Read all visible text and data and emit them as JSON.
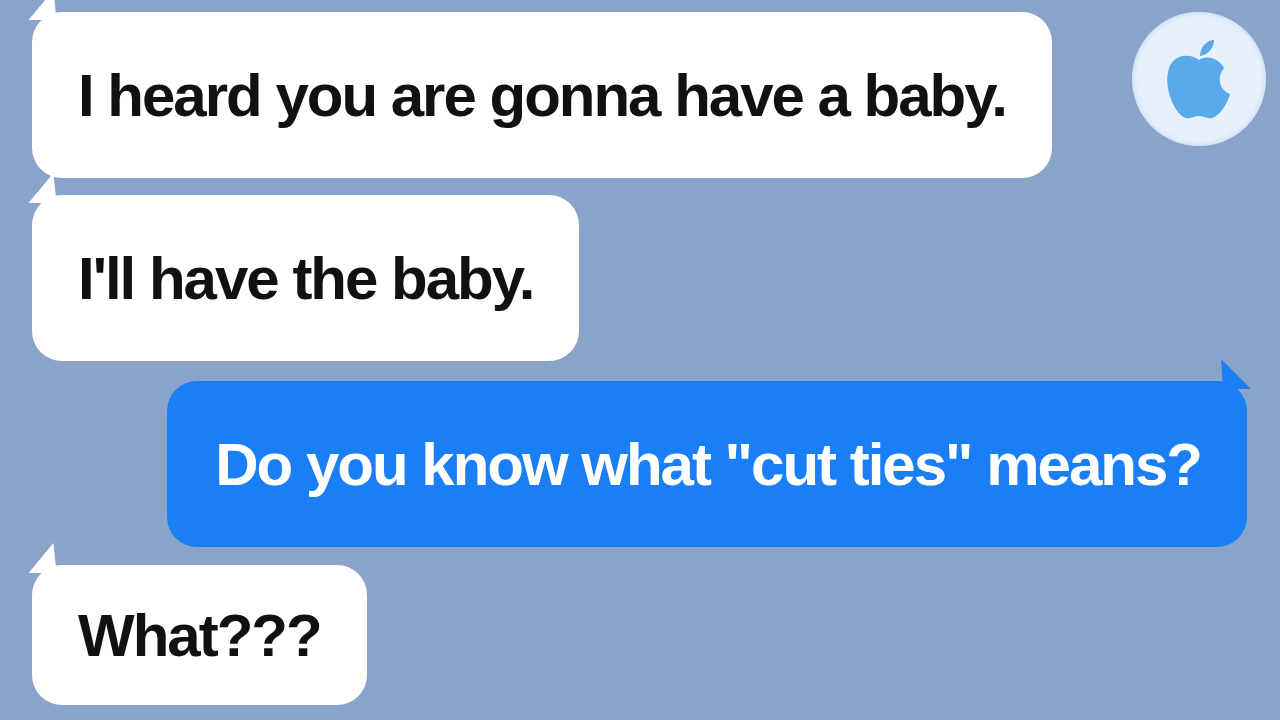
{
  "messages": [
    {
      "text": "I heard you are gonna have a baby.",
      "kind": "incoming"
    },
    {
      "text": "I'll have the baby.",
      "kind": "incoming"
    },
    {
      "text": "Do you know what \"cut ties\" means?",
      "kind": "outgoing"
    },
    {
      "text": "What???",
      "kind": "incoming"
    }
  ]
}
